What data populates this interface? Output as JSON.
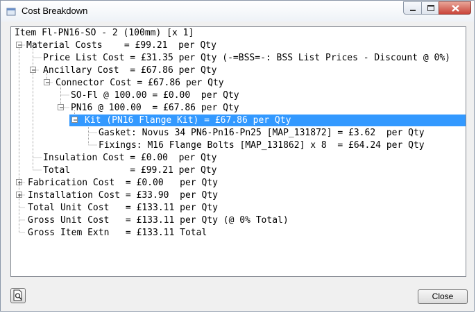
{
  "window": {
    "title": "Cost Breakdown"
  },
  "tree": {
    "root": "Item Fl-PN16-SO - 2 (100mm) [x 1]",
    "material_costs": "Material Costs    = £99.21  per Qty",
    "price_list_cost": "Price List Cost = £31.35 per Qty (-=BSS=-: BSS List Prices - Discount @ 0%)",
    "ancillary_cost": "Ancillary Cost  = £67.86 per Qty",
    "connector_cost": "Connector Cost = £67.86 per Qty",
    "so_fl": "SO-Fl @ 100.00 = £0.00  per Qty",
    "pn16": "PN16 @ 100.00  = £67.86 per Qty",
    "kit": "Kit (PN16 Flange Kit) = £67.86 per Qty",
    "gasket": "Gasket: Novus 34 PN6-Pn16-Pn25 [MAP_131872] = £3.62  per Qty",
    "fixings": "Fixings: M16 Flange Bolts [MAP_131862] x 8  = £64.24 per Qty",
    "insulation_cost": "Insulation Cost = £0.00  per Qty",
    "total": "Total           = £99.21 per Qty",
    "fabrication_cost": "Fabrication Cost  = £0.00   per Qty",
    "installation_cost": "Installation Cost = £33.90  per Qty",
    "total_unit_cost": "Total Unit Cost   = £133.11 per Qty",
    "gross_unit_cost": "Gross Unit Cost   = £133.11 per Qty (@ 0% Total)",
    "gross_item_extn": "Gross Item Extn   = £133.11 Total"
  },
  "buttons": {
    "close": "Close"
  },
  "colors": {
    "selection": "#3399ff",
    "tree_lines": "#a0a0a0"
  },
  "icons": {
    "app": "app-icon",
    "print_preview": "print-preview-icon",
    "minimize": "minimize-icon",
    "maximize": "maximize-icon",
    "close": "close-icon"
  }
}
